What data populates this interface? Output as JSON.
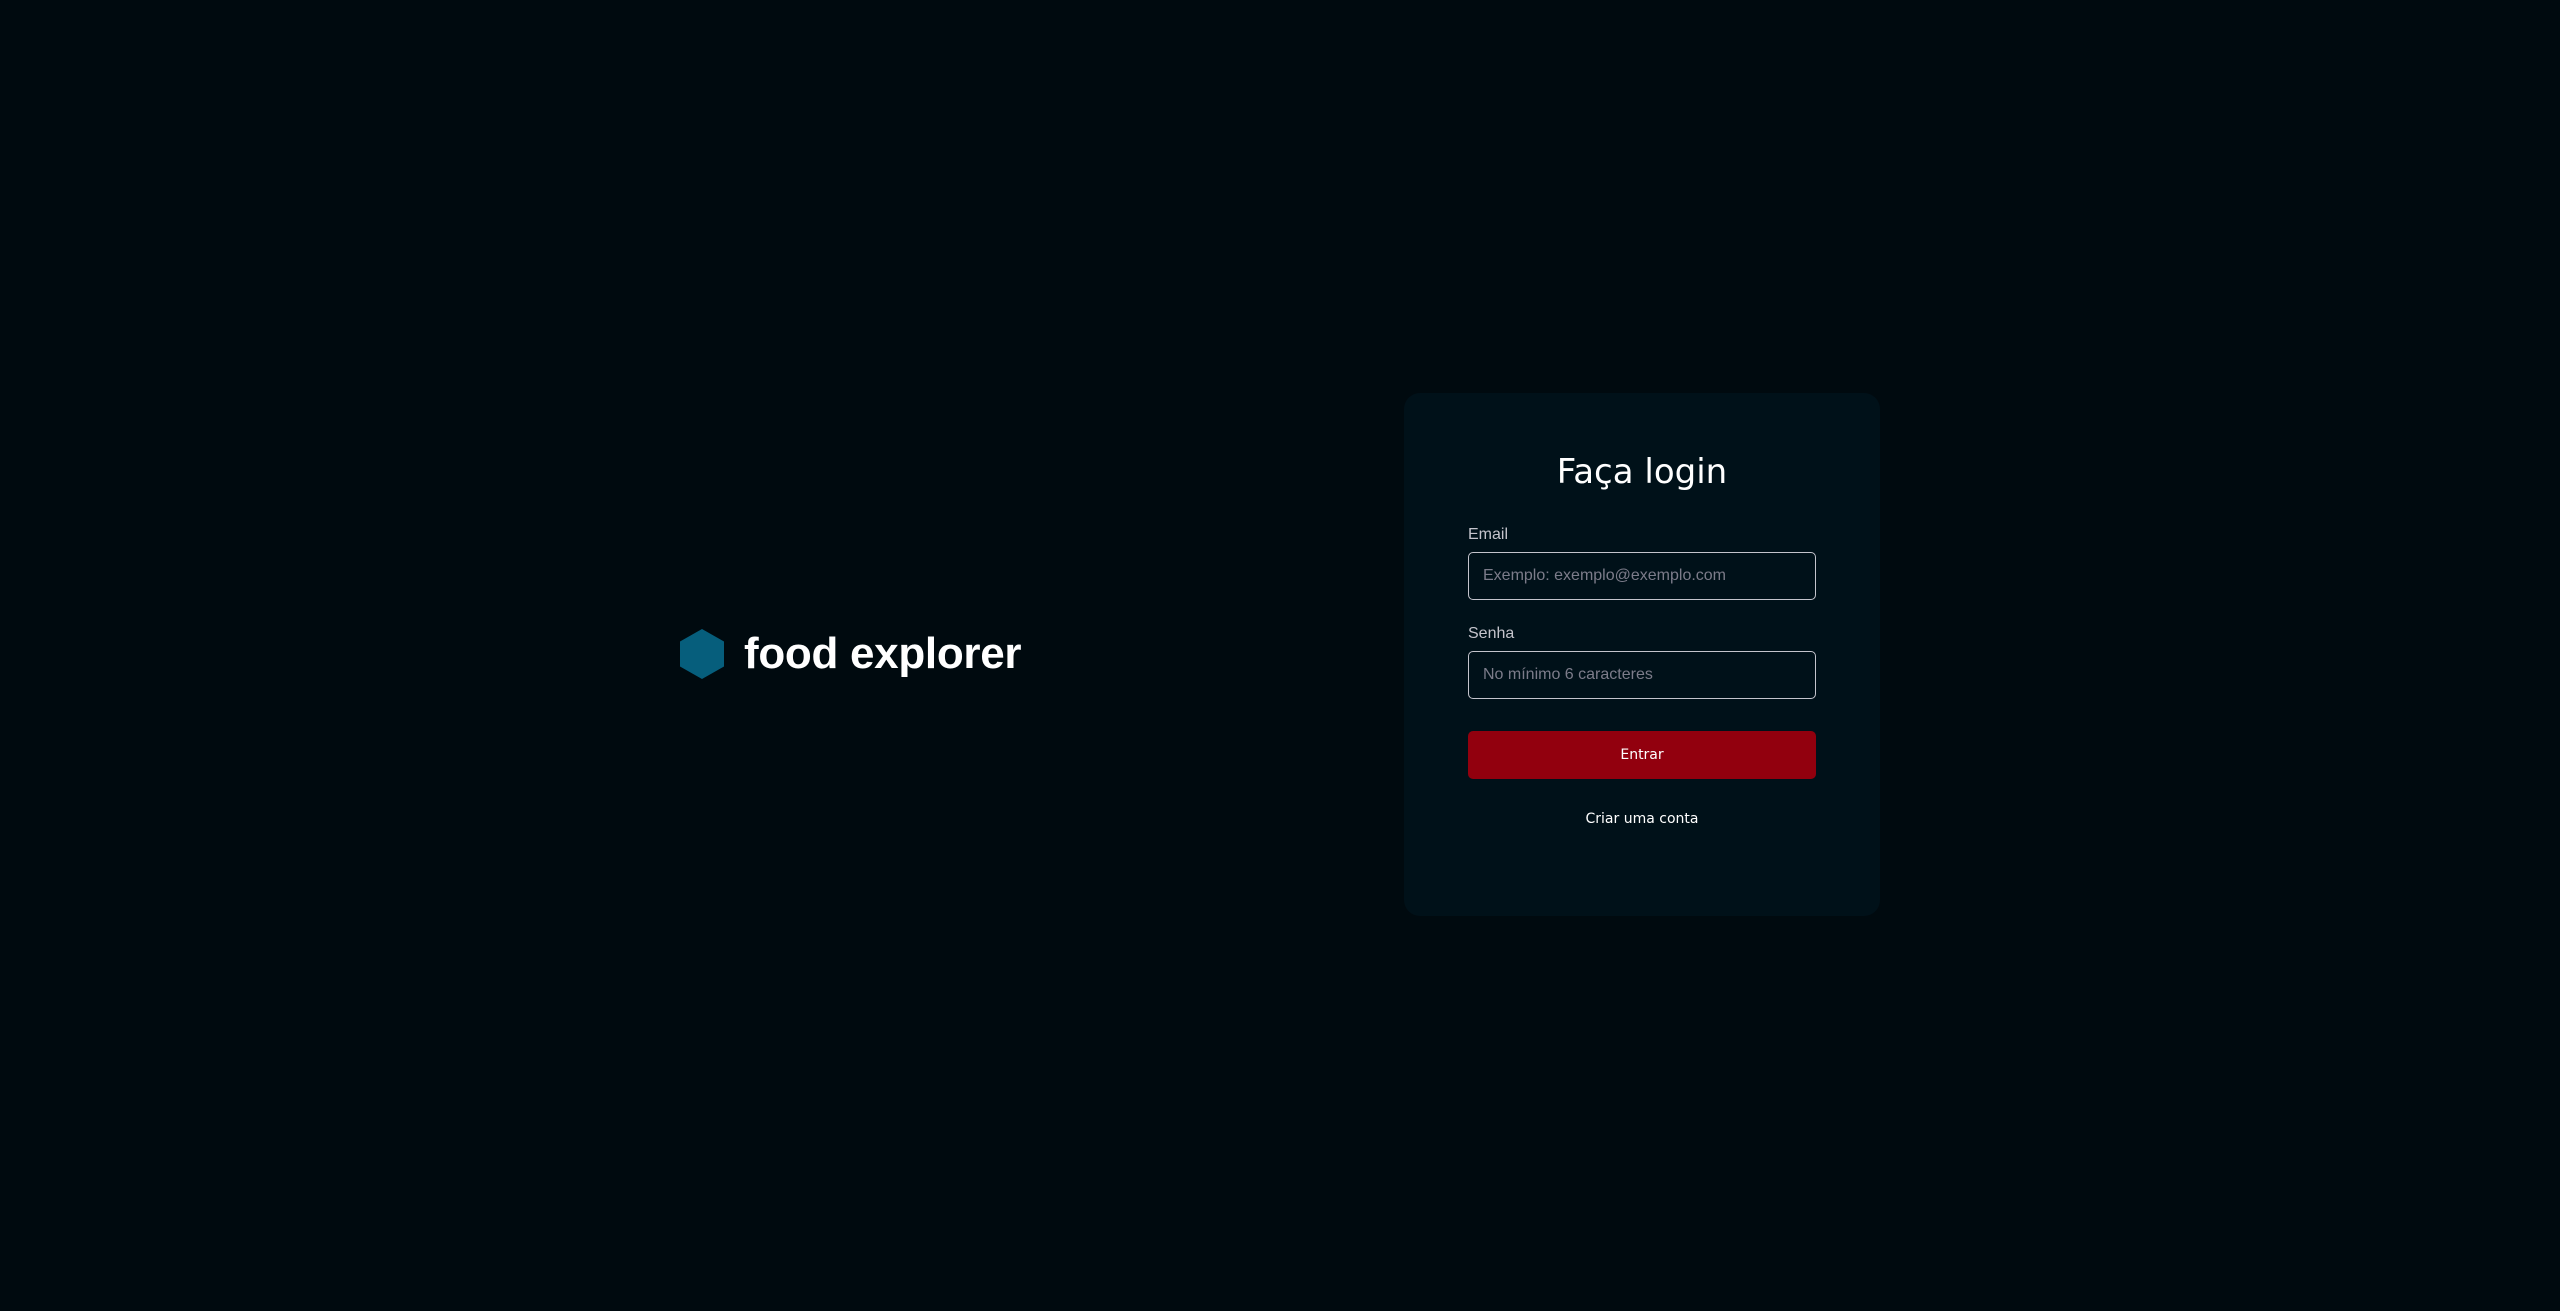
{
  "brand": {
    "name": "food explorer",
    "icon": "hexagon-icon",
    "icon_color": "#065e7c"
  },
  "login": {
    "title": "Faça login",
    "email": {
      "label": "Email",
      "placeholder": "Exemplo: exemplo@exemplo.com",
      "value": ""
    },
    "password": {
      "label": "Senha",
      "placeholder": "No mínimo 6 caracteres",
      "value": ""
    },
    "submit_label": "Entrar",
    "create_account_label": "Criar uma conta"
  },
  "colors": {
    "background": "#000a0f",
    "card": "#001119",
    "primary_button": "#92000e",
    "input_border": "#c4c4cc"
  }
}
